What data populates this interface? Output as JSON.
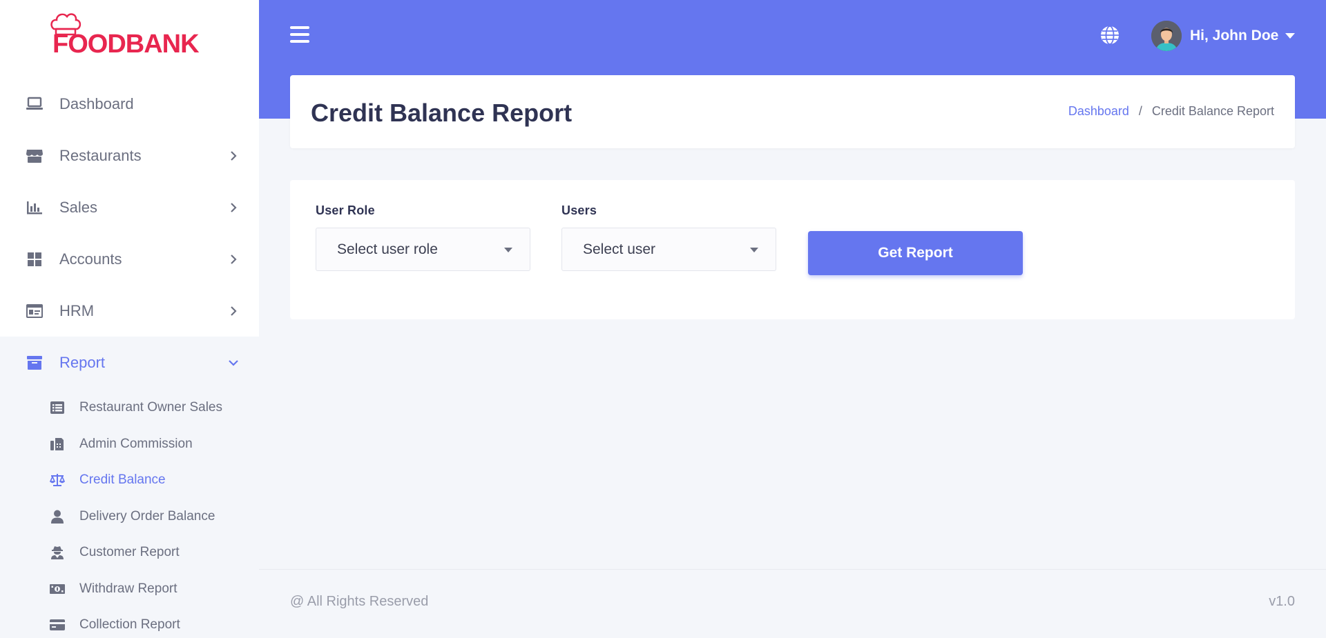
{
  "logo": {
    "text": "FOODBANK",
    "icon": "chef-hat-icon",
    "color": "#e8264f"
  },
  "colors": {
    "primary": "#6576ef",
    "text_muted": "#6b6f80",
    "heading": "#2f3353"
  },
  "sidebar": {
    "items": [
      {
        "label": "Dashboard",
        "icon": "laptop-icon",
        "has_chevron": false
      },
      {
        "label": "Restaurants",
        "icon": "store-icon",
        "has_chevron": true
      },
      {
        "label": "Sales",
        "icon": "chart-bar-icon",
        "has_chevron": true
      },
      {
        "label": "Accounts",
        "icon": "grid-icon",
        "has_chevron": true
      },
      {
        "label": "HRM",
        "icon": "id-card-icon",
        "has_chevron": true
      },
      {
        "label": "Report",
        "icon": "archive-icon",
        "has_chevron": true,
        "expanded": true
      }
    ],
    "report_sub": [
      {
        "label": "Restaurant Owner Sales",
        "icon": "list-icon"
      },
      {
        "label": "Admin Commission",
        "icon": "fax-icon"
      },
      {
        "label": "Credit Balance",
        "icon": "balance-scale-icon",
        "active": true
      },
      {
        "label": "Delivery Order Balance",
        "icon": "user-icon"
      },
      {
        "label": "Customer Report",
        "icon": "user-secret-icon"
      },
      {
        "label": "Withdraw Report",
        "icon": "money-bill-icon"
      },
      {
        "label": "Collection Report",
        "icon": "credit-card-icon"
      }
    ]
  },
  "header": {
    "user_greeting": "Hi, John Doe",
    "menu_icon": "hamburger-icon",
    "language_icon": "globe-icon"
  },
  "page": {
    "title": "Credit Balance Report",
    "breadcrumb": {
      "home": "Dashboard",
      "separator": "/",
      "current": "Credit Balance Report"
    }
  },
  "form": {
    "user_role_label": "User Role",
    "user_role_value": "Select user role",
    "users_label": "Users",
    "users_value": "Select user",
    "submit_label": "Get Report"
  },
  "footer": {
    "copyright": "@ All Rights Reserved",
    "version": "v1.0"
  }
}
